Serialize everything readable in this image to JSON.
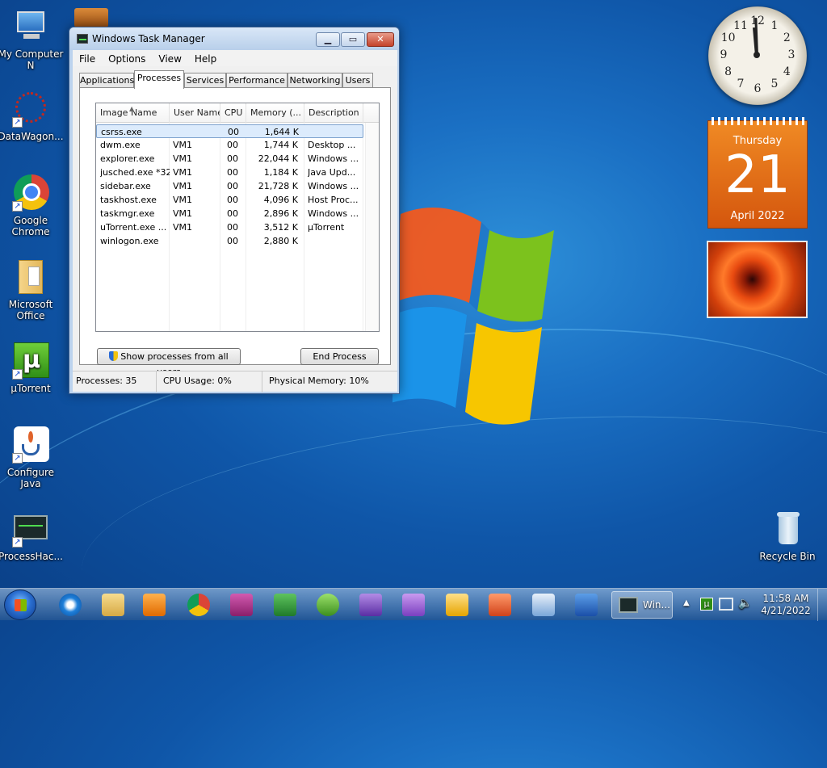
{
  "desktop_icons": [
    {
      "label": "My Computer N",
      "icon": "computer-icon"
    },
    {
      "label": "DataWagon...",
      "icon": "datawagon-icon"
    },
    {
      "label": "Google Chrome",
      "icon": "chrome-icon"
    },
    {
      "label": "Microsoft Office",
      "icon": "folder-icon"
    },
    {
      "label": "µTorrent",
      "icon": "utorrent-icon"
    },
    {
      "label": "Configure Java",
      "icon": "java-icon"
    },
    {
      "label": "ProcessHac...",
      "icon": "processhacker-icon"
    },
    {
      "label": "Recycle Bin",
      "icon": "recycle-bin-icon"
    }
  ],
  "window": {
    "title": "Windows Task Manager",
    "menu": [
      "File",
      "Options",
      "View",
      "Help"
    ],
    "tabs": [
      "Applications",
      "Processes",
      "Services",
      "Performance",
      "Networking",
      "Users"
    ],
    "active_tab": "Processes",
    "columns": [
      "Image Name",
      "User Name",
      "CPU",
      "Memory (...",
      "Description"
    ],
    "rows": [
      {
        "name": "csrss.exe",
        "user": "",
        "cpu": "00",
        "mem": "1,644 K",
        "desc": ""
      },
      {
        "name": "dwm.exe",
        "user": "VM1",
        "cpu": "00",
        "mem": "1,744 K",
        "desc": "Desktop ..."
      },
      {
        "name": "explorer.exe",
        "user": "VM1",
        "cpu": "00",
        "mem": "22,044 K",
        "desc": "Windows ..."
      },
      {
        "name": "jusched.exe *32",
        "user": "VM1",
        "cpu": "00",
        "mem": "1,184 K",
        "desc": "Java Upd..."
      },
      {
        "name": "sidebar.exe",
        "user": "VM1",
        "cpu": "00",
        "mem": "21,728 K",
        "desc": "Windows ..."
      },
      {
        "name": "taskhost.exe",
        "user": "VM1",
        "cpu": "00",
        "mem": "4,096 K",
        "desc": "Host Proc..."
      },
      {
        "name": "taskmgr.exe",
        "user": "VM1",
        "cpu": "00",
        "mem": "2,896 K",
        "desc": "Windows ..."
      },
      {
        "name": "uTorrent.exe ...",
        "user": "VM1",
        "cpu": "00",
        "mem": "3,512 K",
        "desc": "µTorrent"
      },
      {
        "name": "winlogon.exe",
        "user": "",
        "cpu": "00",
        "mem": "2,880 K",
        "desc": ""
      }
    ],
    "show_all_label": "Show processes from all users",
    "end_process_label": "End Process",
    "status": {
      "processes": "Processes: 35",
      "cpu": "CPU Usage: 0%",
      "memory": "Physical Memory: 10%"
    }
  },
  "gadgets": {
    "clock_numbers": [
      "12",
      "1",
      "2",
      "3",
      "4",
      "5",
      "6",
      "7",
      "8",
      "9",
      "10",
      "11"
    ],
    "calendar": {
      "day": "Thursday",
      "date": "21",
      "month": "April 2022"
    }
  },
  "taskbar": {
    "active_label": "Win...",
    "time": "11:58 AM",
    "date": "4/21/2022",
    "pins": [
      "ie-icon",
      "explorer-icon",
      "media-player-icon",
      "chrome-icon",
      "access-icon",
      "excel-icon",
      "sync-icon",
      "infopath-icon",
      "onenote-icon",
      "outlook-icon",
      "powerpoint-icon",
      "publisher-icon",
      "word-icon"
    ]
  }
}
